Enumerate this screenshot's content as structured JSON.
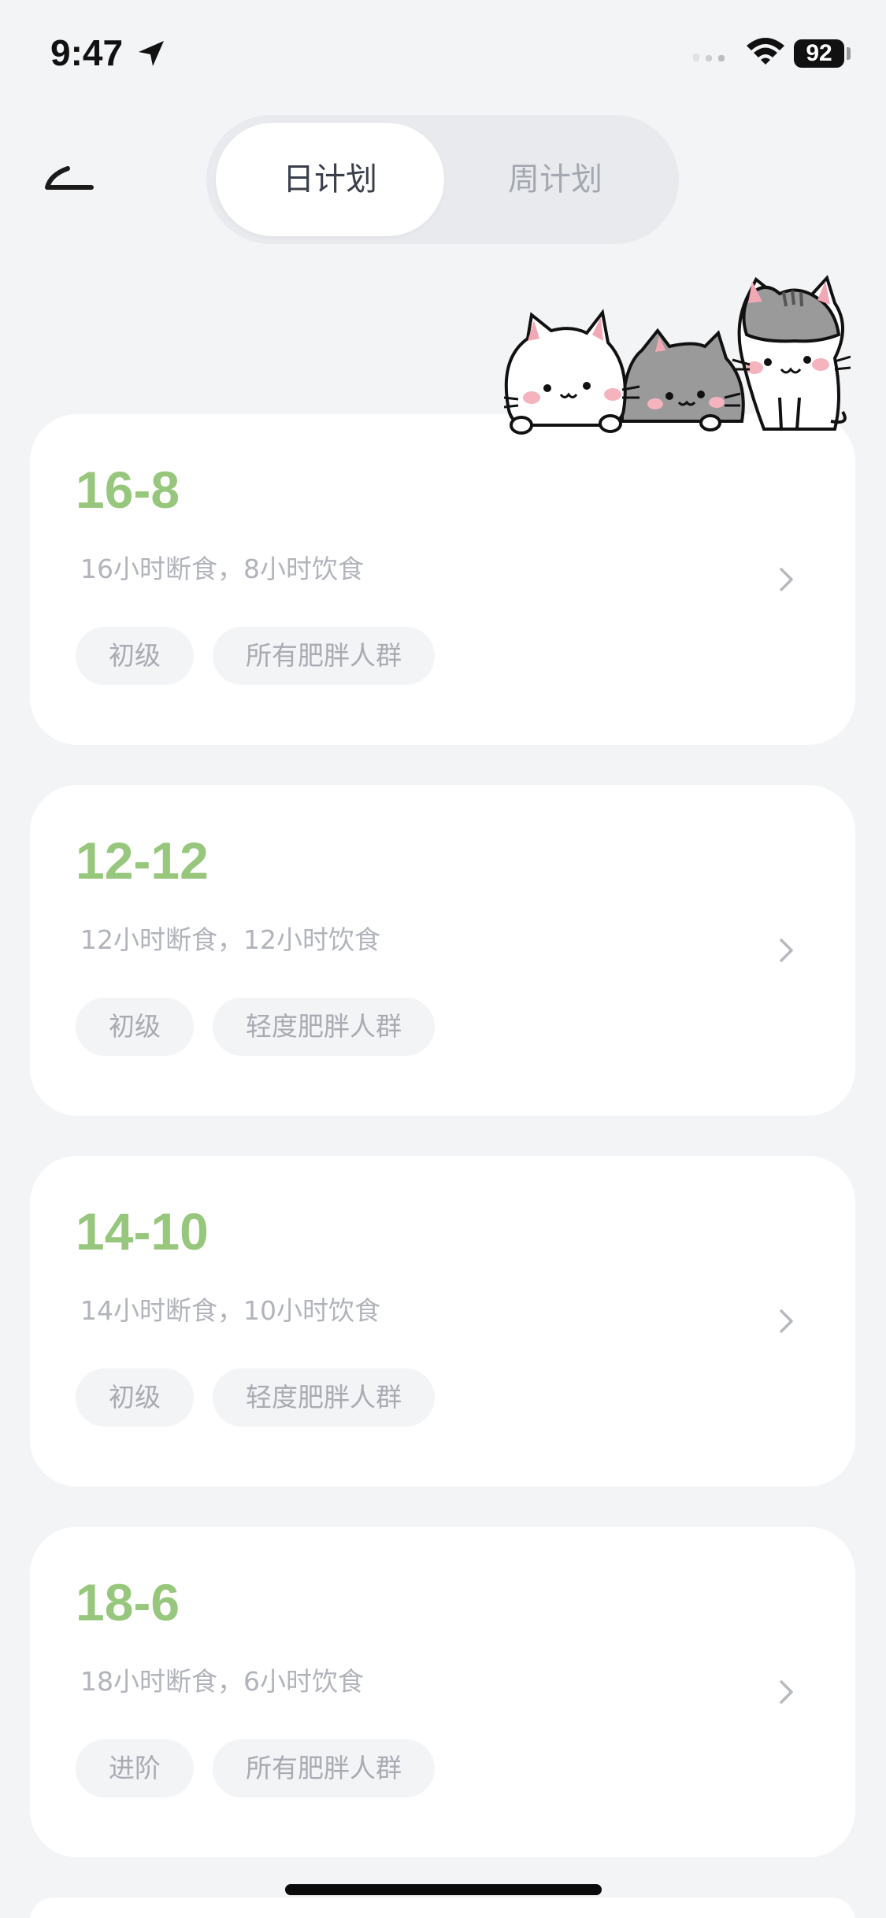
{
  "status_bar": {
    "time": "9:47",
    "battery": "92"
  },
  "header": {
    "tabs": [
      {
        "label": "日计划",
        "active": true
      },
      {
        "label": "周计划",
        "active": false
      }
    ]
  },
  "colors": {
    "accent_green": "#97c77c",
    "background": "#f3f4f6",
    "card": "#ffffff"
  },
  "plans": [
    {
      "title": "16-8",
      "description": "16小时断食，8小时饮食",
      "tags": [
        "初级",
        "所有肥胖人群"
      ]
    },
    {
      "title": "12-12",
      "description": "12小时断食，12小时饮食",
      "tags": [
        "初级",
        "轻度肥胖人群"
      ]
    },
    {
      "title": "14-10",
      "description": "14小时断食，10小时饮食",
      "tags": [
        "初级",
        "轻度肥胖人群"
      ]
    },
    {
      "title": "18-6",
      "description": "18小时断食，6小时饮食",
      "tags": [
        "进阶",
        "所有肥胖人群"
      ]
    }
  ],
  "icons": {
    "back": "back-arrow-icon",
    "chevron": "chevron-right-icon",
    "illustration": "three-cats-illustration"
  }
}
